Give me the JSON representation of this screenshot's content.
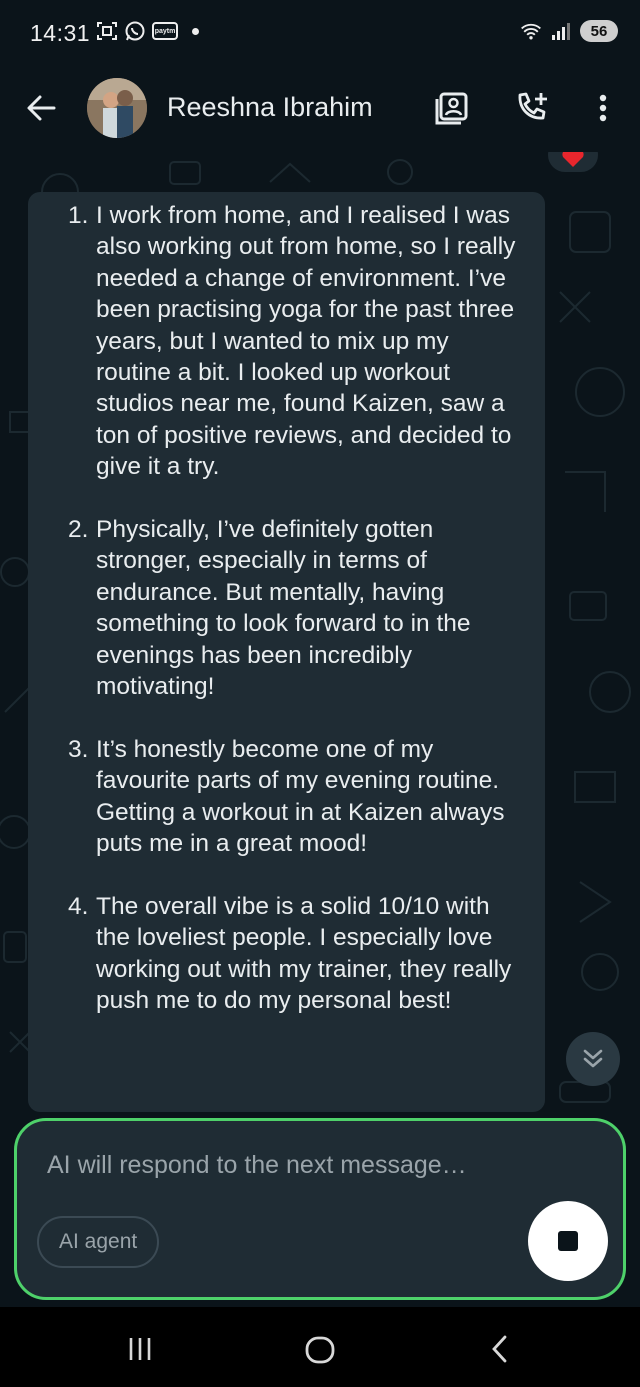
{
  "status_bar": {
    "time": "14:31",
    "left_icons": [
      "screenshot-icon",
      "whatsapp-icon",
      "paytm-icon",
      "notification-dot"
    ],
    "paytm_label": "paytm",
    "battery": "56"
  },
  "header": {
    "contact_name": "Reeshna Ibrahim",
    "actions": [
      "contact-card-icon",
      "add-call-icon",
      "more-vert-icon"
    ]
  },
  "chat": {
    "reaction": "heart",
    "message_items": [
      {
        "number": "1.",
        "text": "I work from home, and I realised I was also working out from home, so I really needed a change of environment. I’ve been practising yoga for the past three years, but I wanted to mix up my routine a bit. I looked up workout studios near me, found Kaizen, saw a ton of positive reviews, and decided to give it a try."
      },
      {
        "number": "2.",
        "text": "Physically, I’ve definitely gotten stronger, especially in terms of endurance. But mentally, having something to look forward to in the evenings has been incredibly motivating!"
      },
      {
        "number": "3.",
        "text": "It’s honestly become one of my favourite parts of my evening routine. Getting a workout in at Kaizen always puts me in a great mood!"
      },
      {
        "number": "4.",
        "text": "The overall vibe is a solid 10/10 with the loveliest people. I especially love working out with my trainer, they really push me to do my personal best!"
      }
    ]
  },
  "composer": {
    "placeholder": "AI will respond to the next message…",
    "chip_label": "AI agent",
    "border_color": "#4ed16a"
  },
  "colors": {
    "background": "#0b141a",
    "bubble": "#1f2c34",
    "text": "#e9edef",
    "accent_green": "#4ed16a"
  }
}
